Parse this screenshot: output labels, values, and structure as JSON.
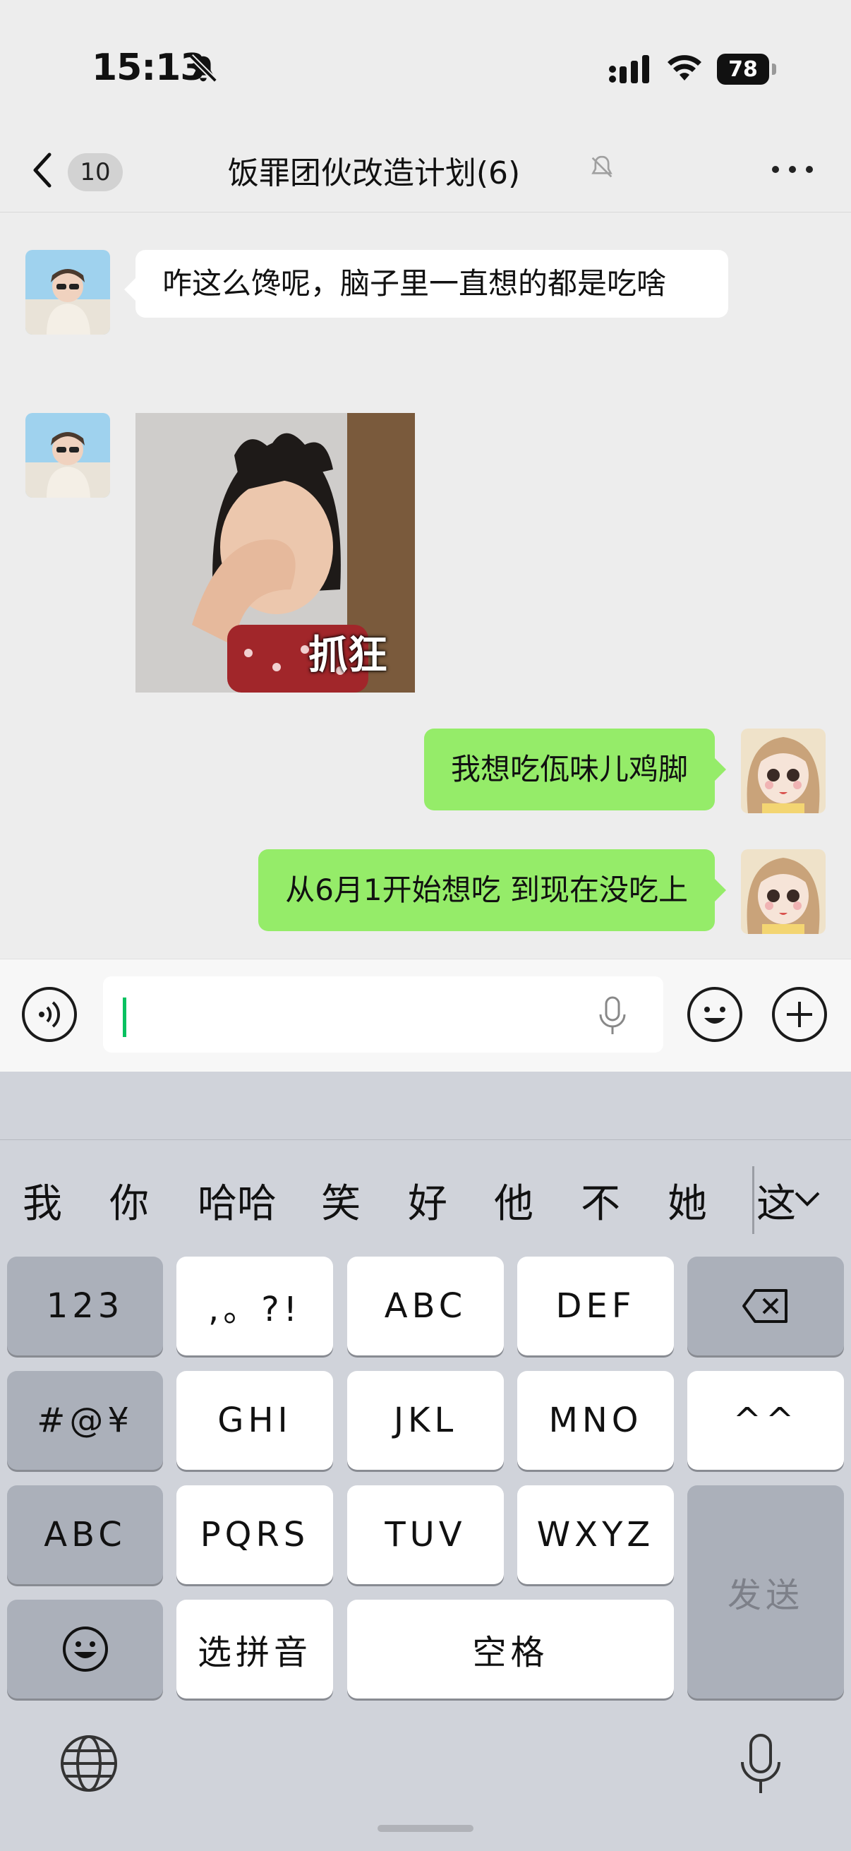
{
  "status": {
    "time": "15:13",
    "battery": "78"
  },
  "nav": {
    "unread_count": "10",
    "title": "饭罪团伙改造计划(6)"
  },
  "messages": [
    {
      "text": "咋这么馋呢，脑子里一直想的都是吃啥"
    },
    {
      "sticker_caption": "抓狂"
    },
    {
      "text": "我想吃佤味儿鸡脚"
    },
    {
      "text": "从6月1开始想吃 到现在没吃上"
    }
  ],
  "input": {
    "value": ""
  },
  "keyboard": {
    "candidates": [
      "我",
      "你",
      "哈哈",
      "笑",
      "好",
      "他",
      "不",
      "她",
      "这"
    ],
    "keys": {
      "num": "123",
      "punct": ",。?!",
      "abc1": "ABC",
      "def": "DEF",
      "sym": "#@¥",
      "ghi": "GHI",
      "jkl": "JKL",
      "mno": "MNO",
      "emoticon": "^^",
      "abc_mode": "ABC",
      "pqrs": "PQRS",
      "tuv": "TUV",
      "wxyz": "WXYZ",
      "pinyin": "选拼音",
      "space": "空格",
      "send": "发送"
    }
  },
  "colors": {
    "sent_bubble": "#95ec69",
    "accent": "#07c160"
  }
}
